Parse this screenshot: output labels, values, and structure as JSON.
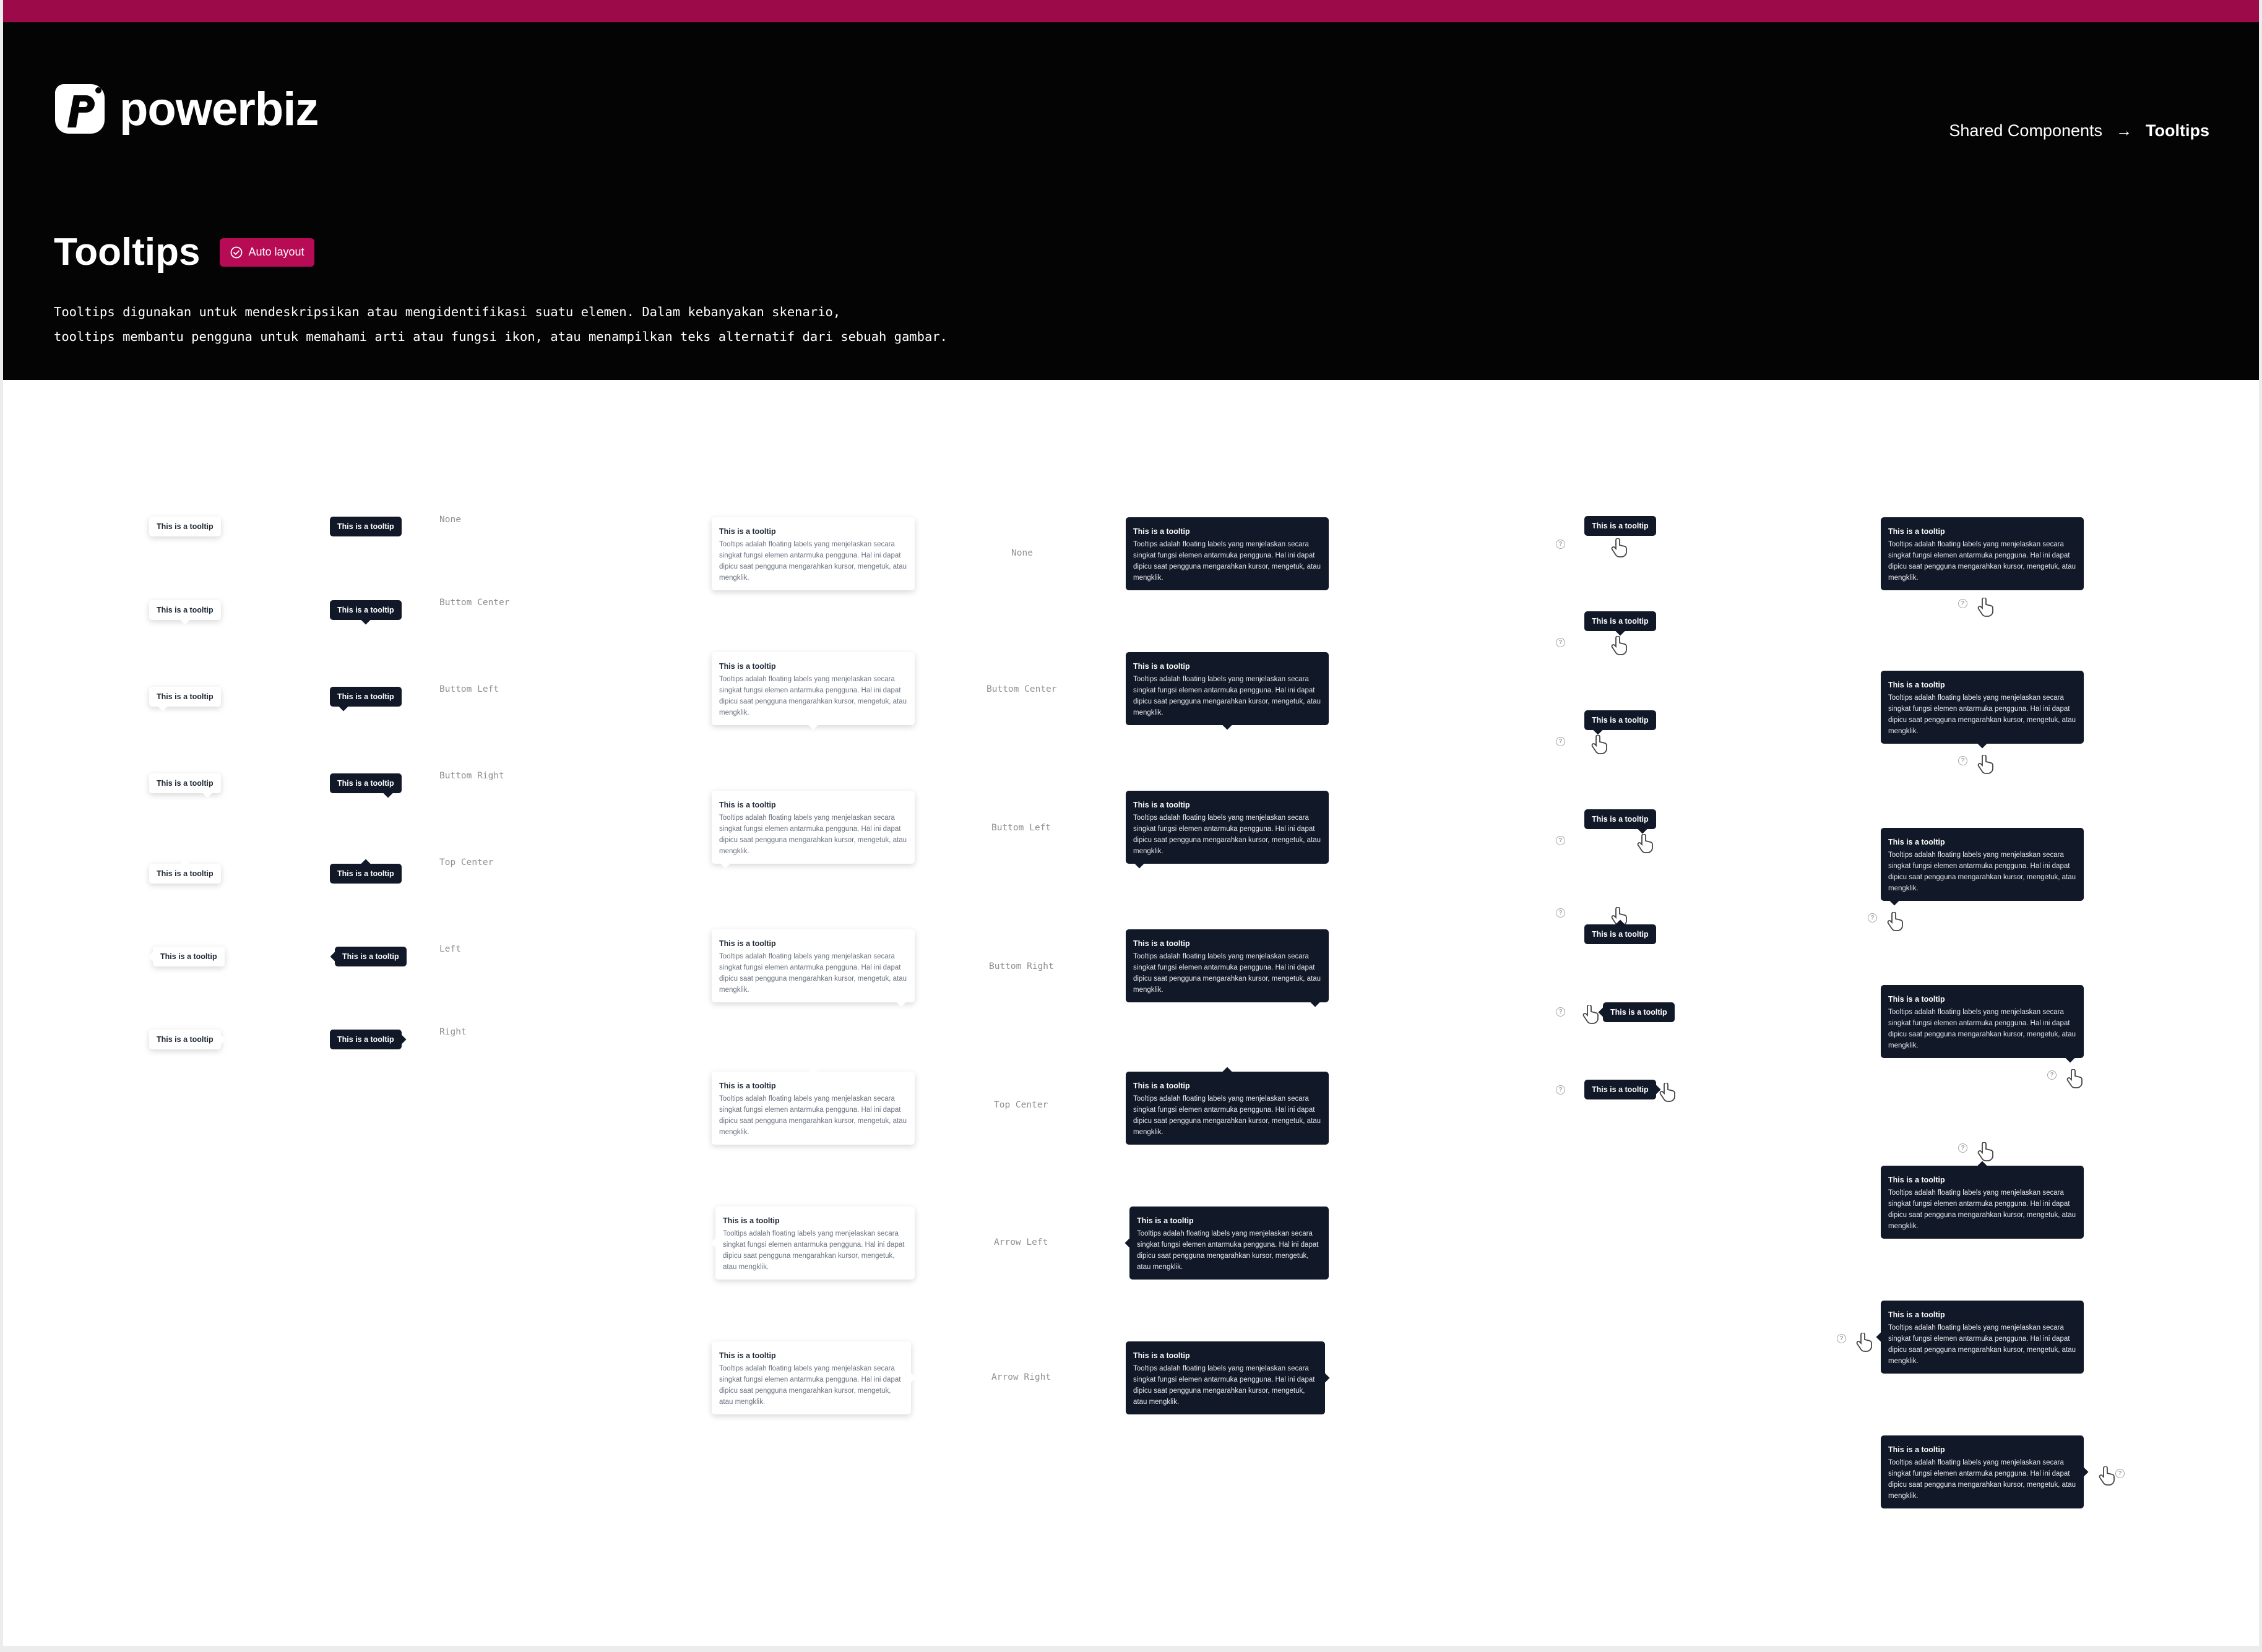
{
  "brand": {
    "name": "powerbiz",
    "accent_color": "#9c0a4a",
    "dark_color": "#111827"
  },
  "breadcrumb": {
    "parent": "Shared Components",
    "separator_icon": "arrow-right-icon",
    "current": "Tooltips"
  },
  "page": {
    "title": "Tooltips",
    "badge": {
      "label": "Auto layout",
      "icon": "check-circle-icon"
    },
    "description_line1": "Tooltips digunakan untuk mendeskripsikan atau mengidentifikasi suatu elemen. Dalam kebanyakan skenario,",
    "description_line2": "tooltips membantu pengguna untuk memahami arti atau fungsi ikon, atau menampilkan teks alternatif dari sebuah gambar."
  },
  "small": {
    "label": "This is a tooltip",
    "positions": {
      "none": "None",
      "bottom_center": "Buttom Center",
      "bottom_left": "Buttom Left",
      "bottom_right": "Buttom Right",
      "top_center": "Top Center",
      "left": "Left",
      "right": "Right"
    }
  },
  "large": {
    "title": "This is a tooltip",
    "body": "Tooltips adalah floating labels yang menjelaskan secara singkat fungsi elemen antarmuka pengguna. Hal ini dapat dipicu saat pengguna mengarahkan kursor, mengetuk, atau mengklik.",
    "positions": {
      "none": "None",
      "bottom_center": "Buttom Center",
      "bottom_left": "Buttom Left",
      "bottom_right": "Buttom Right",
      "top_center": "Top Center",
      "arrow_left": "Arrow Left",
      "arrow_right": "Arrow Right"
    }
  },
  "icons": {
    "help": "help-circle-icon",
    "cursor": "hand-pointer-icon",
    "help_glyph": "?"
  }
}
